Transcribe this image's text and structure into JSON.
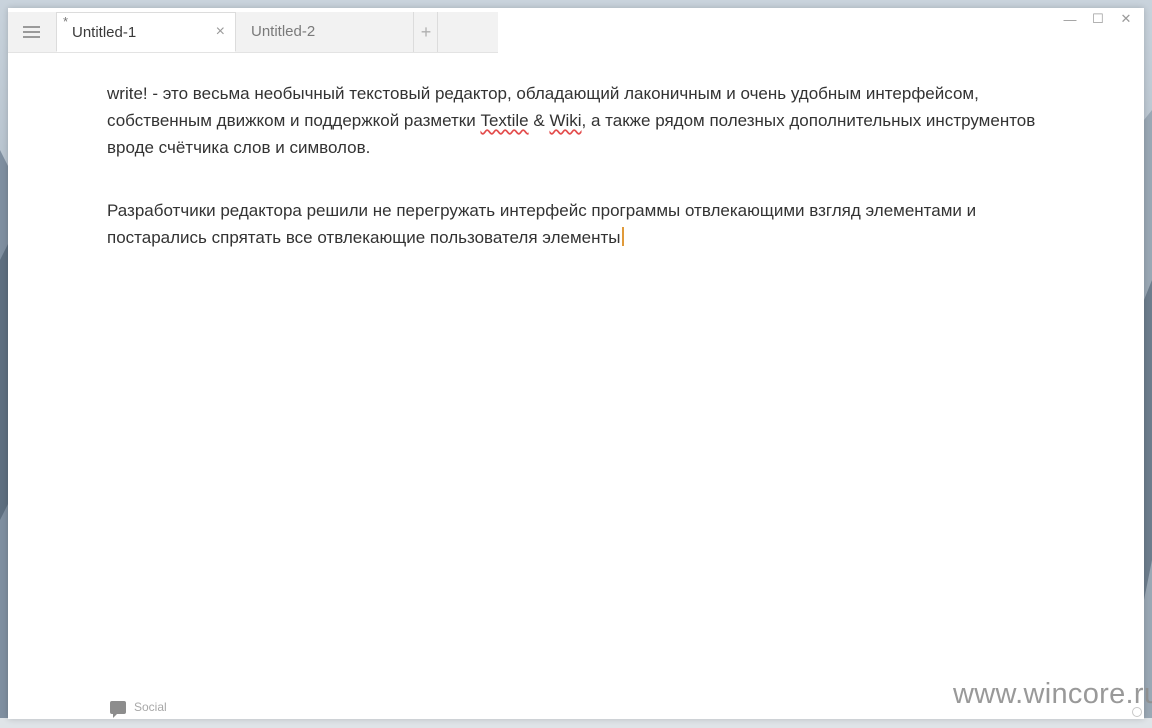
{
  "app": {
    "name": "write!"
  },
  "tabs": [
    {
      "label": "Untitled-1",
      "dirty_marker": "*",
      "close_glyph": "×",
      "active": true
    },
    {
      "label": "Untitled-2",
      "active": false
    }
  ],
  "tabstrip": {
    "add_glyph": "+"
  },
  "window_controls": {
    "minimize": "—",
    "maximize": "☐",
    "close": "✕"
  },
  "document": {
    "p1_before_textile": "write! - это весьма необычный текстовый редактор, обладающий лаконичным и очень удобным интерфейсом, собственным движком и поддержкой разметки ",
    "p1_textile": "Textile",
    "p1_amp": " & ",
    "p1_wiki": "Wiki",
    "p1_after_wiki": ", а также рядом полезных дополнительных инструментов вроде счётчика слов и символов.",
    "p2": "Разработчики редактора решили не перегружать интерфейс программы отвлекающими взгляд элементами и постарались спрятать все отвлекающие пользователя элементы"
  },
  "status_bar": {
    "social_label": "Social",
    "icon": "comment-icon"
  },
  "watermark": "www.wincore.ru",
  "colors": {
    "caret": "#e09a3a",
    "spellcheck": "#e34c4c"
  }
}
